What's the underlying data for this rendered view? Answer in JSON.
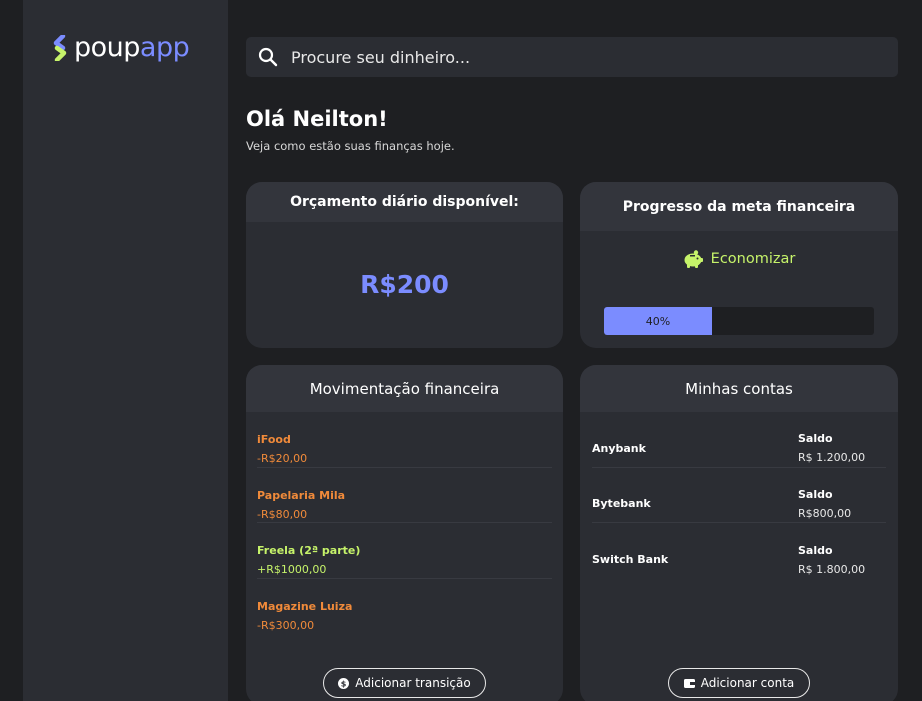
{
  "brand": {
    "name_part1": "poup",
    "name_part2": "app",
    "accent": "#7b8cff"
  },
  "search": {
    "placeholder": "Procure seu dinheiro...",
    "icon": "search-icon"
  },
  "greeting": {
    "title": "Olá Neilton!",
    "subtitle": "Veja como estão suas finanças hoje."
  },
  "budget": {
    "title": "Orçamento diário disponível:",
    "value": "R$200"
  },
  "goal": {
    "title": "Progresso da meta financeira",
    "label": "Economizar",
    "icon": "piggy-bank-icon",
    "progress": 0.4,
    "progress_label": "40%"
  },
  "movements": {
    "title": "Movimentação financeira",
    "items": [
      {
        "name": "iFood",
        "amount": "-R$20,00",
        "type": "negative"
      },
      {
        "name": "Papelaria Mila",
        "amount": "-R$80,00",
        "type": "negative"
      },
      {
        "name": "Freela (2ª parte)",
        "amount": "+R$1000,00",
        "type": "positive"
      },
      {
        "name": "Magazine Luiza",
        "amount": "-R$300,00",
        "type": "negative"
      }
    ],
    "add_button": "Adicionar transição"
  },
  "accounts": {
    "title": "Minhas contas",
    "items": [
      {
        "name": "Anybank",
        "balance_label": "Saldo",
        "balance": "R$ 1.200,00"
      },
      {
        "name": "Bytebank",
        "balance_label": "Saldo",
        "balance": "R$800,00"
      },
      {
        "name": "Switch Bank",
        "balance_label": "Saldo",
        "balance": "R$ 1.800,00"
      }
    ],
    "add_button": "Adicionar conta"
  },
  "colors": {
    "negative": "#f08a3a",
    "positive": "#c6f36a",
    "card": "#2b2d33",
    "background": "#1e1f22"
  }
}
